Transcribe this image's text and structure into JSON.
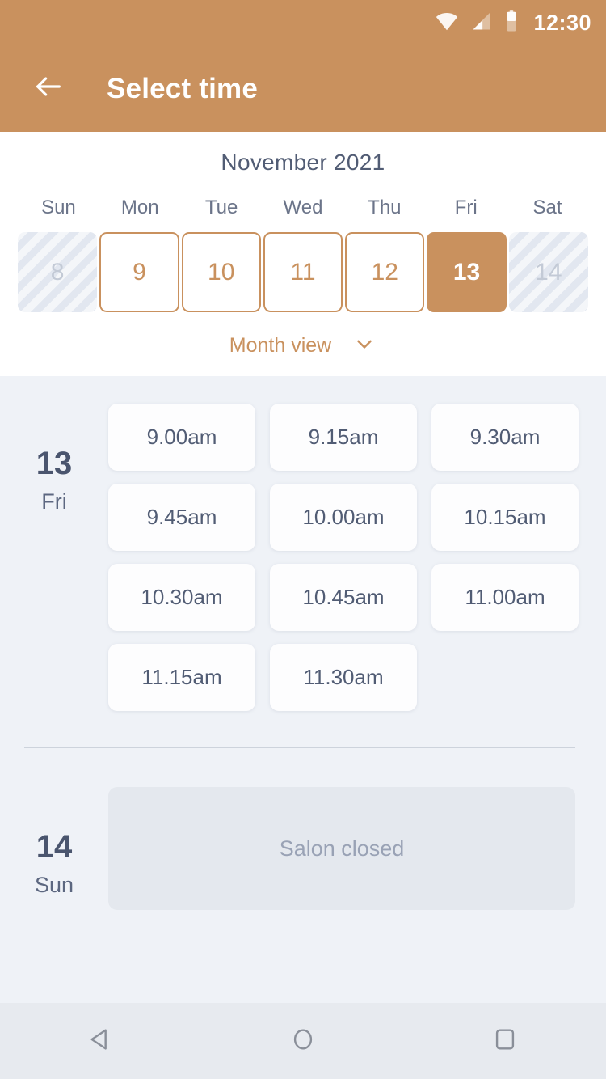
{
  "status_bar": {
    "time": "12:30",
    "icons": [
      "wifi-icon",
      "cellular-signal-icon",
      "battery-icon"
    ]
  },
  "app_bar": {
    "back_icon": "back-arrow-icon",
    "title": "Select time"
  },
  "calendar": {
    "month_title": "November 2021",
    "weekdays": [
      "Sun",
      "Mon",
      "Tue",
      "Wed",
      "Thu",
      "Fri",
      "Sat"
    ],
    "days": [
      {
        "number": "8",
        "state": "disabled"
      },
      {
        "number": "9",
        "state": "available"
      },
      {
        "number": "10",
        "state": "available"
      },
      {
        "number": "11",
        "state": "available"
      },
      {
        "number": "12",
        "state": "available"
      },
      {
        "number": "13",
        "state": "selected"
      },
      {
        "number": "14",
        "state": "disabled"
      }
    ],
    "month_view_toggle": {
      "label": "Month view",
      "icon": "chevron-down-icon"
    }
  },
  "schedule": {
    "days": [
      {
        "date_number": "13",
        "day_name": "Fri",
        "status": "open",
        "slots": [
          "9.00am",
          "9.15am",
          "9.30am",
          "9.45am",
          "10.00am",
          "10.15am",
          "10.30am",
          "10.45am",
          "11.00am",
          "11.15am",
          "11.30am"
        ]
      },
      {
        "date_number": "14",
        "day_name": "Sun",
        "status": "closed",
        "closed_message": "Salon closed",
        "slots": []
      }
    ]
  },
  "nav_bar": {
    "buttons": [
      "back-nav-icon",
      "home-nav-icon",
      "recents-nav-icon"
    ]
  },
  "colors": {
    "accent": "#C9915E",
    "page_background": "#EFF2F7",
    "panel_background": "#FFFFFF",
    "text_dark": "#515C74",
    "closed_box": "#E4E8EE"
  }
}
